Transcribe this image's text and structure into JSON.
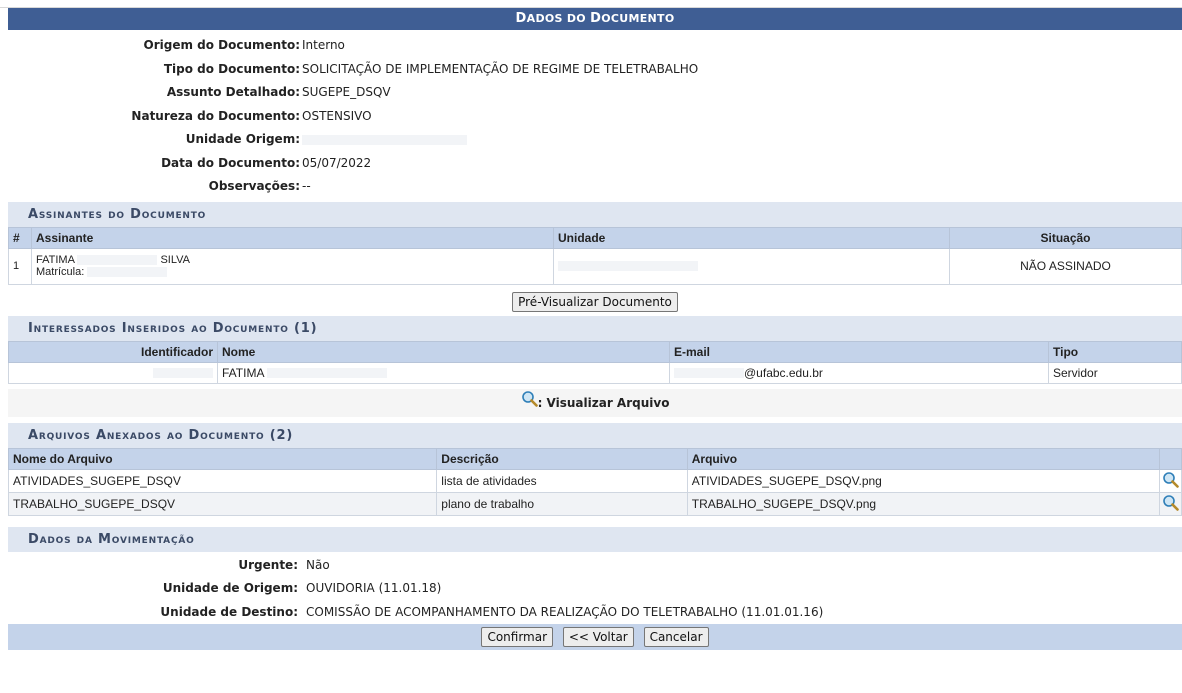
{
  "caption": {
    "p1": "D",
    "p2": "ADOS DO ",
    "p3": "D",
    "p4": "OCUMENTO"
  },
  "doc": {
    "origem_label": "Origem do Documento:",
    "origem": "Interno",
    "tipo_label": "Tipo do Documento:",
    "tipo": "SOLICITAÇÃO DE IMPLEMENTAÇÃO DE REGIME DE TELETRABALHO",
    "assunto_label": "Assunto Detalhado:",
    "assunto": "SUGEPE_DSQV",
    "natureza_label": "Natureza do Documento:",
    "natureza": "OSTENSIVO",
    "unidade_label": "Unidade Origem:",
    "unidade": "",
    "data_label": "Data do Documento:",
    "data": "05/07/2022",
    "obs_label": "Observações:",
    "obs": "--"
  },
  "assinantes": {
    "title": "Assinantes do Documento",
    "headers": {
      "num": "#",
      "assinante": "Assinante",
      "unidade": "Unidade",
      "situacao": "Situação"
    },
    "rows": [
      {
        "num": "1",
        "first": "FATIMA",
        "last": "SILVA",
        "matricula_label": "Matrícula:",
        "situacao": "NÃO ASSINADO"
      }
    ]
  },
  "previsualizar_button": "Pré-Visualizar Documento",
  "interessados": {
    "title": "Interessados Inseridos ao Documento (1)",
    "headers": {
      "id": "Identificador",
      "nome": "Nome",
      "email": "E-mail",
      "tipo": "Tipo"
    },
    "rows": [
      {
        "nome": "FATIMA",
        "email": "@ufabc.edu.br",
        "tipo": "Servidor"
      }
    ]
  },
  "legend": {
    "text": ": Visualizar Arquivo"
  },
  "arquivos": {
    "title": "Arquivos Anexados ao Documento (2)",
    "headers": {
      "nome": "Nome do Arquivo",
      "descricao": "Descrição",
      "arquivo": "Arquivo"
    },
    "rows": [
      {
        "nome": "ATIVIDADES_SUGEPE_DSQV",
        "descricao": "lista de atividades",
        "arquivo": "ATIVIDADES_SUGEPE_DSQV.png"
      },
      {
        "nome": "TRABALHO_SUGEPE_DSQV",
        "descricao": "plano de trabalho",
        "arquivo": "TRABALHO_SUGEPE_DSQV.png"
      }
    ]
  },
  "movimentacao": {
    "title": "Dados da Movimentação",
    "urgente_label": "Urgente:",
    "urgente": "Não",
    "origem_label": "Unidade de Origem:",
    "origem": "OUVIDORIA (11.01.18)",
    "destino_label": "Unidade de Destino:",
    "destino": "COMISSÃO DE ACOMPANHAMENTO DA REALIZAÇÃO DO TELETRABALHO (11.01.01.16)"
  },
  "footer": {
    "confirmar": "Confirmar",
    "voltar": "<< Voltar",
    "cancelar": "Cancelar"
  },
  "colors": {
    "caption_bg": "#3f5e94",
    "section_bg": "#dfe6f1",
    "header_bg": "#c4d3ea",
    "status_red": "#e00000"
  }
}
